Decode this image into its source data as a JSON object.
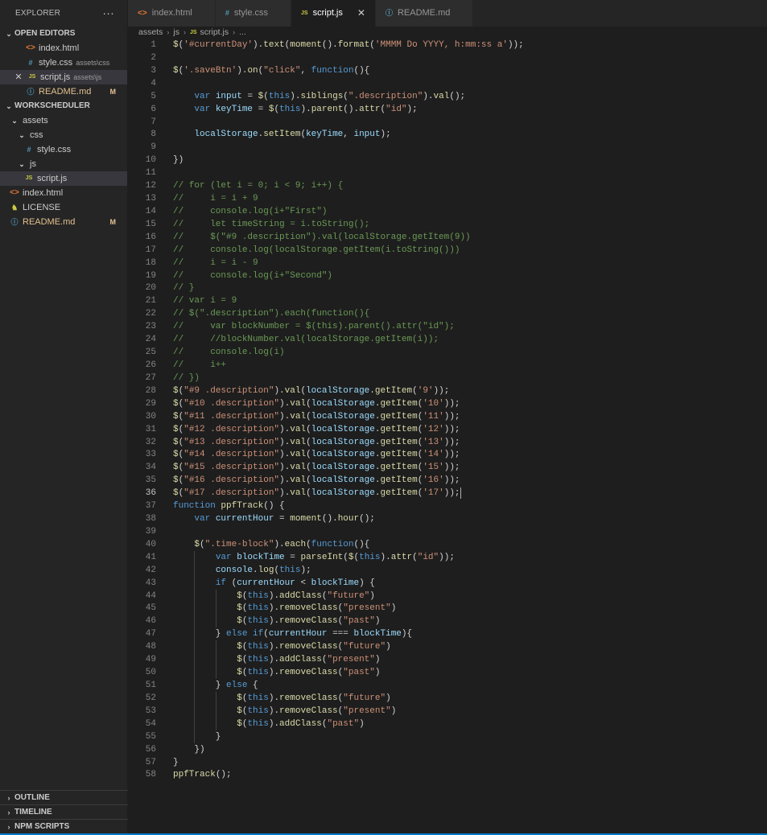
{
  "explorer": {
    "title": "EXPLORER",
    "more_label": "···",
    "open_editors": {
      "label": "OPEN EDITORS",
      "items": [
        {
          "name": "index.html",
          "path": "",
          "icon": "html-file-icon",
          "badge": "",
          "active": false
        },
        {
          "name": "style.css",
          "path": "assets\\css",
          "icon": "css-file-icon",
          "badge": "",
          "active": false
        },
        {
          "name": "script.js",
          "path": "assets\\js",
          "icon": "js-file-icon",
          "badge": "",
          "active": true
        },
        {
          "name": "README.md",
          "path": "",
          "icon": "info-file-icon",
          "badge": "M",
          "active": false
        }
      ]
    },
    "workspace": {
      "label": "WORKSCHEDULER",
      "items": [
        {
          "name": "assets",
          "type": "folder",
          "depth": 0
        },
        {
          "name": "css",
          "type": "folder",
          "depth": 1
        },
        {
          "name": "style.css",
          "type": "css",
          "depth": 2
        },
        {
          "name": "js",
          "type": "folder",
          "depth": 1
        },
        {
          "name": "script.js",
          "type": "js",
          "depth": 2,
          "active": true
        },
        {
          "name": "index.html",
          "type": "html",
          "depth": 0
        },
        {
          "name": "LICENSE",
          "type": "license",
          "depth": 0
        },
        {
          "name": "README.md",
          "type": "info",
          "depth": 0,
          "badge": "M"
        }
      ]
    },
    "bottom_sections": [
      "OUTLINE",
      "TIMELINE",
      "NPM SCRIPTS"
    ]
  },
  "tabs": [
    {
      "label": "index.html",
      "icon": "html-file-icon",
      "active": false
    },
    {
      "label": "style.css",
      "icon": "css-file-icon",
      "active": false
    },
    {
      "label": "script.js",
      "icon": "js-file-icon",
      "active": true
    },
    {
      "label": "README.md",
      "icon": "info-file-icon",
      "active": false
    }
  ],
  "breadcrumb": {
    "parts": [
      "assets",
      "js"
    ],
    "file": "script.js",
    "tail": "..."
  },
  "editor": {
    "current_line": 36,
    "lines": [
      "$('#currentDay').text(moment().format('MMMM Do YYYY, h:mm:ss a'));",
      "",
      "$('.saveBtn').on(\"click\", function(){",
      "",
      "    var input = $(this).siblings(\".description\").val();",
      "    var keyTime = $(this).parent().attr(\"id\");",
      "",
      "    localStorage.setItem(keyTime, input);",
      "",
      "})",
      "",
      "// for (let i = 0; i < 9; i++) {",
      "//     i = i + 9",
      "//     console.log(i+\"First\")",
      "//     let timeString = i.toString();",
      "//     $(\"#9 .description\").val(localStorage.getItem(9))",
      "//     console.log(localStorage.getItem(i.toString()))",
      "//     i = i - 9",
      "//     console.log(i+\"Second\")",
      "// }",
      "// var i = 9",
      "// $(\".description\").each(function(){",
      "//     var blockNumber = $(this).parent().attr(\"id\");",
      "//     //blockNumber.val(localStorage.getItem(i));",
      "//     console.log(i)",
      "//     i++",
      "// })",
      "$(\"#9 .description\").val(localStorage.getItem('9'));",
      "$(\"#10 .description\").val(localStorage.getItem('10'));",
      "$(\"#11 .description\").val(localStorage.getItem('11'));",
      "$(\"#12 .description\").val(localStorage.getItem('12'));",
      "$(\"#13 .description\").val(localStorage.getItem('13'));",
      "$(\"#14 .description\").val(localStorage.getItem('14'));",
      "$(\"#15 .description\").val(localStorage.getItem('15'));",
      "$(\"#16 .description\").val(localStorage.getItem('16'));",
      "$(\"#17 .description\").val(localStorage.getItem('17'));",
      "function ppfTrack() {",
      "    var currentHour = moment().hour();",
      "",
      "    $(\".time-block\").each(function(){",
      "        var blockTime = parseInt($(this).attr(\"id\"));",
      "        console.log(this);",
      "        if (currentHour < blockTime) {",
      "            $(this).addClass(\"future\")",
      "            $(this).removeClass(\"present\")",
      "            $(this).removeClass(\"past\")",
      "        } else if(currentHour === blockTime){",
      "            $(this).removeClass(\"future\")",
      "            $(this).addClass(\"present\")",
      "            $(this).removeClass(\"past\")",
      "        } else {",
      "            $(this).removeClass(\"future\")",
      "            $(this).removeClass(\"present\")",
      "            $(this).addClass(\"past\")",
      "        }",
      "    })",
      "}",
      "ppfTrack();"
    ]
  },
  "colors": {
    "accent": "#007acc",
    "background": "#1e1e1e",
    "sidebar": "#252526",
    "keyword": "#569cd6",
    "string": "#ce9178",
    "comment": "#6a9955",
    "function": "#dcdcaa",
    "variable": "#9cdcfe",
    "modified": "#e2c08d"
  }
}
